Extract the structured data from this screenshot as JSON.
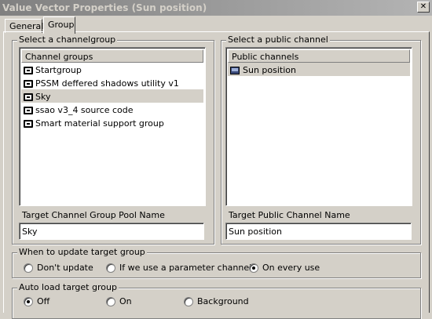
{
  "window": {
    "title": "Value Vector Properties (Sun position)",
    "close_glyph": "✕"
  },
  "tabs": [
    {
      "label": "General",
      "active": false
    },
    {
      "label": "Group",
      "active": true
    }
  ],
  "channelgroup": {
    "group_label": "Select a channelgroup",
    "list_header": "Channel groups",
    "items": [
      {
        "label": "Startgroup",
        "icon": "folder-icon",
        "selected": false
      },
      {
        "label": "PSSM deffered shadows utility v1",
        "icon": "folder-icon",
        "selected": false
      },
      {
        "label": "Sky",
        "icon": "folder-icon",
        "selected": true
      },
      {
        "label": "ssao v3_4 source code",
        "icon": "folder-icon",
        "selected": false
      },
      {
        "label": "Smart material support group",
        "icon": "folder-icon",
        "selected": false
      }
    ],
    "target_label": "Target Channel Group Pool Name",
    "target_value": "Sky"
  },
  "public_channel": {
    "group_label": "Select a public channel",
    "list_header": "Public channels",
    "items": [
      {
        "label": "Sun position",
        "icon": "channel-icon",
        "selected": true
      }
    ],
    "target_label": "Target Public Channel Name",
    "target_value": "Sun position"
  },
  "update": {
    "group_label": "When to update target group",
    "options": [
      {
        "label": "Don't update",
        "checked": false
      },
      {
        "label": "If we use a parameter channel",
        "checked": false
      },
      {
        "label": "On every use",
        "checked": true
      }
    ]
  },
  "autoload": {
    "group_label": "Auto load target group",
    "options": [
      {
        "label": "Off",
        "checked": true
      },
      {
        "label": "On",
        "checked": false
      },
      {
        "label": "Background",
        "checked": false
      }
    ]
  }
}
